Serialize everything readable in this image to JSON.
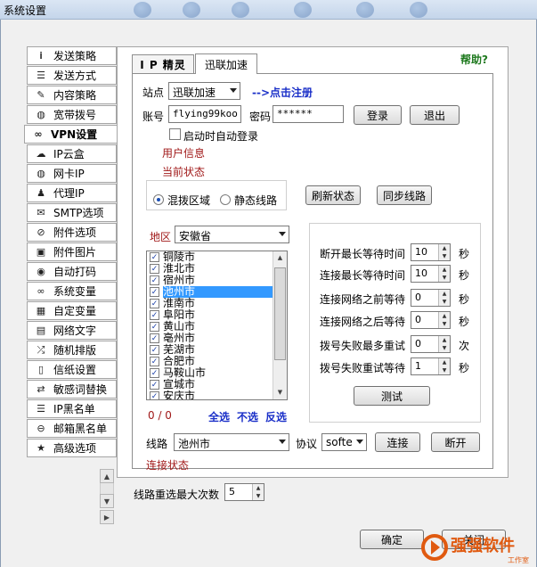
{
  "window": {
    "title": "系统设置"
  },
  "nav": [
    {
      "label": "发送策略",
      "icon": "i-icon"
    },
    {
      "label": "发送方式",
      "icon": "list-icon"
    },
    {
      "label": "内容策略",
      "icon": "pencil-icon"
    },
    {
      "label": "宽带拨号",
      "icon": "globe-icon"
    },
    {
      "label": "VPN设置",
      "icon": "link-icon"
    },
    {
      "label": "IP云盒",
      "icon": "cloud-icon"
    },
    {
      "label": "网卡IP",
      "icon": "globe-icon"
    },
    {
      "label": "代理IP",
      "icon": "user-icon"
    },
    {
      "label": "SMTP选项",
      "icon": "mail-icon"
    },
    {
      "label": "附件选项",
      "icon": "clip-icon"
    },
    {
      "label": "附件图片",
      "icon": "image-icon"
    },
    {
      "label": "自动打码",
      "icon": "eye-icon"
    },
    {
      "label": "系统变量",
      "icon": "infinity-icon"
    },
    {
      "label": "自定变量",
      "icon": "grid-icon"
    },
    {
      "label": "网络文字",
      "icon": "book-icon"
    },
    {
      "label": "随机排版",
      "icon": "shuffle-icon"
    },
    {
      "label": "信纸设置",
      "icon": "file-icon"
    },
    {
      "label": "敏感词替换",
      "icon": "swap-icon"
    },
    {
      "label": "IP黑名单",
      "icon": "list-icon"
    },
    {
      "label": "邮箱黑名单",
      "icon": "block-icon"
    },
    {
      "label": "高级选项",
      "icon": "star-icon"
    }
  ],
  "help": "帮助?",
  "tabs": {
    "t1": "I P 精灵",
    "t2": "迅联加速"
  },
  "site": {
    "label": "站点",
    "value": "迅联加速",
    "register": "-->点击注册"
  },
  "account": {
    "label": "账号",
    "value": "flying99koo"
  },
  "password": {
    "label": "密码",
    "value": "******"
  },
  "buttons": {
    "login": "登录",
    "logout": "退出",
    "refresh": "刷新状态",
    "sync": "同步线路",
    "connect": "连接",
    "disconnect": "断开",
    "test": "测试",
    "ok": "确定",
    "close": "关闭"
  },
  "autologin": "启动时自动登录",
  "userinfo": "用户信息",
  "curstatus": "当前状态",
  "mode": {
    "mixed": "混拨区域",
    "static": "静态线路"
  },
  "region": {
    "label": "地区",
    "value": "安徽省"
  },
  "cities": [
    "铜陵市",
    "淮北市",
    "宿州市",
    "池州市",
    "淮南市",
    "阜阳市",
    "黄山市",
    "亳州市",
    "芜湖市",
    "合肥市",
    "马鞍山市",
    "宣城市",
    "安庆市"
  ],
  "selectedCity": "池州市",
  "counter": "0 / 0",
  "selectLinks": {
    "all": "全选",
    "none": "不选",
    "invert": "反选"
  },
  "timeouts": [
    {
      "label": "断开最长等待时间",
      "value": "10",
      "unit": "秒"
    },
    {
      "label": "连接最长等待时间",
      "value": "10",
      "unit": "秒"
    },
    {
      "label": "连接网络之前等待",
      "value": "0",
      "unit": "秒"
    },
    {
      "label": "连接网络之后等待",
      "value": "0",
      "unit": "秒"
    },
    {
      "label": "拨号失败最多重试",
      "value": "0",
      "unit": "次"
    },
    {
      "label": "拨号失败重试等待",
      "value": "1",
      "unit": "秒"
    }
  ],
  "line": {
    "label": "线路",
    "value": "池州市"
  },
  "protocol": {
    "label": "协议",
    "value": "softe"
  },
  "connstatus": "连接状态",
  "maxretry": {
    "label": "线路重选最大次数",
    "value": "5"
  },
  "watermark": {
    "main": "强强软件",
    "sub": "工作室"
  }
}
